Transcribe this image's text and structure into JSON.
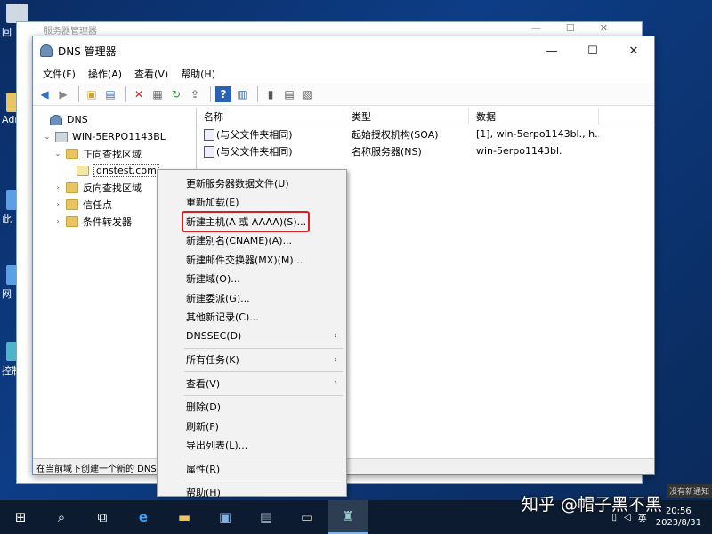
{
  "desktop": {
    "icons": [
      {
        "label": "回"
      },
      {
        "label": "Admi"
      },
      {
        "label": "此"
      },
      {
        "label": "网"
      },
      {
        "label": "控制"
      }
    ]
  },
  "bg_window": {
    "title": "服务器管理器"
  },
  "window": {
    "title": "DNS 管理器",
    "controls": {
      "minimize": "—",
      "maximize": "☐",
      "close": "✕"
    }
  },
  "menubar": [
    "文件(F)",
    "操作(A)",
    "查看(V)",
    "帮助(H)"
  ],
  "tree": {
    "root": "DNS",
    "server": "WIN-5ERPO1143BL",
    "forward_zones": "正向查找区域",
    "zone": "dnstest.com",
    "reverse_zones": "反向查找区域",
    "trust_points": "信任点",
    "conditional_forwarders": "条件转发器"
  },
  "list": {
    "headers": [
      "名称",
      "类型",
      "数据"
    ],
    "rows": [
      {
        "name": "(与父文件夹相同)",
        "type": "起始授权机构(SOA)",
        "data": "[1], win-5erpo1143bl., h..."
      },
      {
        "name": "(与父文件夹相同)",
        "type": "名称服务器(NS)",
        "data": "win-5erpo1143bl."
      }
    ]
  },
  "statusbar": "在当前域下创建一个新的 DNS",
  "context_menu": {
    "items": [
      "更新服务器数据文件(U)",
      "重新加载(E)",
      "新建主机(A 或 AAAA)(S)...",
      "新建别名(CNAME)(A)...",
      "新建邮件交换器(MX)(M)...",
      "新建域(O)...",
      "新建委派(G)...",
      "其他新记录(C)...",
      "DNSSEC(D)",
      "所有任务(K)",
      "查看(V)",
      "删除(D)",
      "刷新(F)",
      "导出列表(L)...",
      "属性(R)",
      "帮助(H)"
    ],
    "highlighted": "新建主机(A 或 AAAA)(S)..."
  },
  "taskbar": {
    "ime": "英",
    "date": "2023/8/31",
    "time": "20:56"
  },
  "watermark": "知乎 @帽子黑不黑",
  "notification_snippet": "没有新通知"
}
